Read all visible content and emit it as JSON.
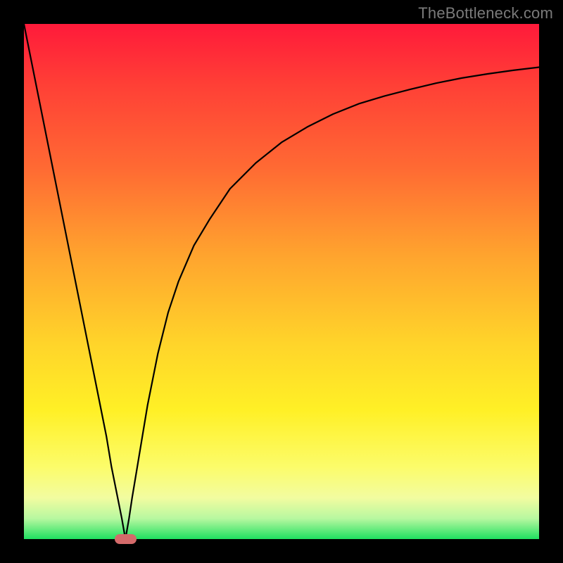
{
  "watermark": "TheBottleneck.com",
  "marker": {
    "x_percent": 19.7,
    "width_percent": 4.2
  },
  "chart_data": {
    "type": "line",
    "title": "",
    "xlabel": "",
    "ylabel": "",
    "xlim": [
      0,
      100
    ],
    "ylim": [
      0,
      100
    ],
    "x": [
      0,
      2,
      4,
      6,
      8,
      10,
      12,
      14,
      16,
      17,
      18,
      19,
      19.7,
      20.4,
      21,
      22,
      23,
      24,
      26,
      28,
      30,
      33,
      36,
      40,
      45,
      50,
      55,
      60,
      65,
      70,
      75,
      80,
      85,
      90,
      95,
      100
    ],
    "values": [
      100,
      90,
      80,
      70,
      60,
      50,
      40,
      30,
      20,
      14,
      9,
      4,
      0,
      4,
      8,
      14,
      20,
      26,
      36,
      44,
      50,
      57,
      62,
      68,
      73,
      77,
      80,
      82.5,
      84.5,
      86,
      87.3,
      88.5,
      89.5,
      90.3,
      91,
      91.6
    ],
    "notes": "Bottleneck-style curve: steep linear drop from 100% at x=0 to minimum at ~19.7%, then asymptotic rise toward ~92% at x=100. Background gradient encodes severity (red=bad top, green=good bottom). A small rounded marker sits at the minimum on the x-axis.",
    "background_gradient": {
      "top": "#ff1a3a",
      "upper_mid": "#ffa42e",
      "mid": "#fff026",
      "lower_mid": "#f2fca0",
      "bottom": "#1fe060"
    },
    "marker_color": "#d46a6a",
    "curve_color": "#000000"
  }
}
